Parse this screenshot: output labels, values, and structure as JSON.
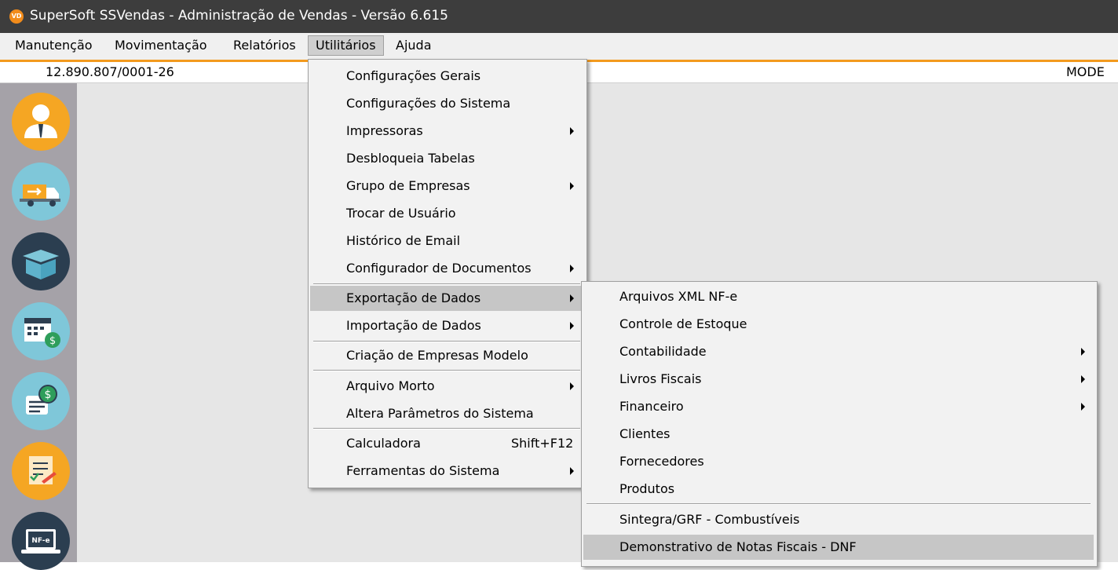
{
  "window": {
    "title": "SuperSoft SSVendas - Administração de Vendas - Versão 6.615",
    "icon_text": "VD"
  },
  "menubar": {
    "items": [
      "Manutenção",
      "Movimentação",
      "Relatórios",
      "Utilitários",
      "Ajuda"
    ]
  },
  "infobar": {
    "cnpj": "12.890.807/0001-26",
    "mode": "MODE"
  },
  "sidebar": {
    "icons": [
      "user-icon",
      "delivery-truck-icon",
      "box-icon",
      "calendar-money-icon",
      "bill-money-icon",
      "checklist-icon",
      "nfe-laptop-icon"
    ]
  },
  "utilitarios_menu": {
    "items": [
      {
        "label": "Configurações Gerais"
      },
      {
        "label": "Configurações do Sistema"
      },
      {
        "label": "Impressoras",
        "submenu": true
      },
      {
        "label": "Desbloqueia Tabelas"
      },
      {
        "label": "Grupo de Empresas",
        "submenu": true
      },
      {
        "label": "Trocar de Usuário"
      },
      {
        "label": "Histórico de Email"
      },
      {
        "label": "Configurador de Documentos",
        "submenu": true
      },
      {
        "label": "Exportação de Dados",
        "submenu": true,
        "highlighted": true
      },
      {
        "label": "Importação de Dados",
        "submenu": true
      },
      {
        "label": "Criação de Empresas Modelo"
      },
      {
        "label": "Arquivo Morto",
        "submenu": true
      },
      {
        "label": "Altera Parâmetros do Sistema"
      },
      {
        "label": "Calculadora",
        "shortcut": "Shift+F12"
      },
      {
        "label": "Ferramentas do Sistema",
        "submenu": true
      }
    ]
  },
  "exportacao_submenu": {
    "items": [
      {
        "label": "Arquivos XML NF-e"
      },
      {
        "label": "Controle de Estoque"
      },
      {
        "label": "Contabilidade",
        "submenu": true
      },
      {
        "label": "Livros Fiscais",
        "submenu": true
      },
      {
        "label": "Financeiro",
        "submenu": true
      },
      {
        "label": "Clientes"
      },
      {
        "label": "Fornecedores"
      },
      {
        "label": "Produtos"
      },
      {
        "label": "Sintegra/GRF - Combustíveis"
      },
      {
        "label": "Demonstrativo de Notas Fiscais - DNF",
        "highlighted": true
      }
    ]
  },
  "colors": {
    "titlebar": "#3d3d3d",
    "accent_orange": "#f39a1e",
    "sidebar": "#a5a2a8",
    "workspace": "#e6e6e6",
    "menu_bg": "#f2f2f2",
    "menu_highlight": "#c6c6c6"
  }
}
